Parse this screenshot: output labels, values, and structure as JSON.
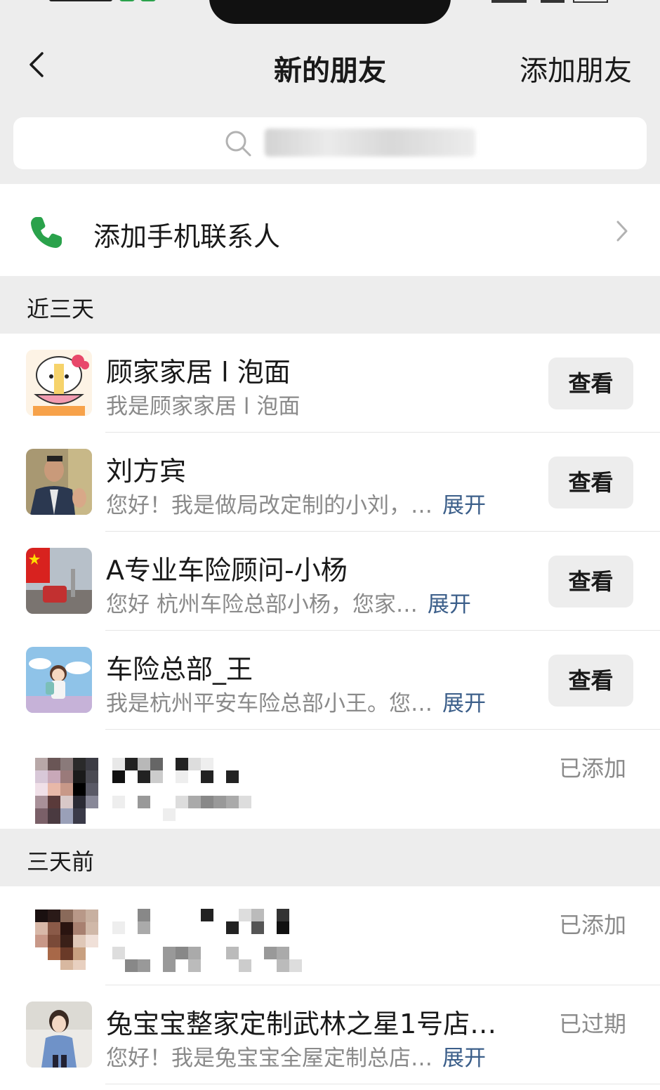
{
  "nav": {
    "title": "新的朋友",
    "action_label": "添加朋友"
  },
  "search": {
    "placeholder": ""
  },
  "phone_contacts": {
    "label": "添加手机联系人"
  },
  "sections": [
    {
      "header": "近三天",
      "items": [
        {
          "name": "顾家家居 l 泡面",
          "message": "我是顾家家居 l 泡面",
          "expand": "",
          "action": "查看"
        },
        {
          "name": "刘方宾",
          "message": "您好！我是做局改定制的小刘，…",
          "expand": "展开",
          "action": "查看"
        },
        {
          "name": "A专业车险顾问-小杨",
          "message": "您好   杭州车险总部小杨，您家…",
          "expand": "展开",
          "action": "查看"
        },
        {
          "name": "车险总部_王",
          "message": "我是杭州平安车险总部小王。您…",
          "expand": "展开",
          "action": "查看"
        },
        {
          "name": "",
          "message": "",
          "expand": "",
          "status": "已添加"
        }
      ]
    },
    {
      "header": "三天前",
      "items": [
        {
          "name": "",
          "message": "",
          "expand": "",
          "status": "已添加"
        },
        {
          "name": "兔宝宝整家定制武林之星1号店…",
          "message": "您好！我是兔宝宝全屋定制总店…",
          "expand": "展开",
          "status": "已过期"
        }
      ]
    }
  ],
  "colors": {
    "background": "#ededed",
    "link_blue": "#3c5f8a",
    "phone_green": "#2aa24b",
    "secondary_text": "#8a8a8a"
  },
  "icons": [
    "back-arrow-icon",
    "search-icon",
    "phone-icon",
    "chevron-right-icon"
  ]
}
